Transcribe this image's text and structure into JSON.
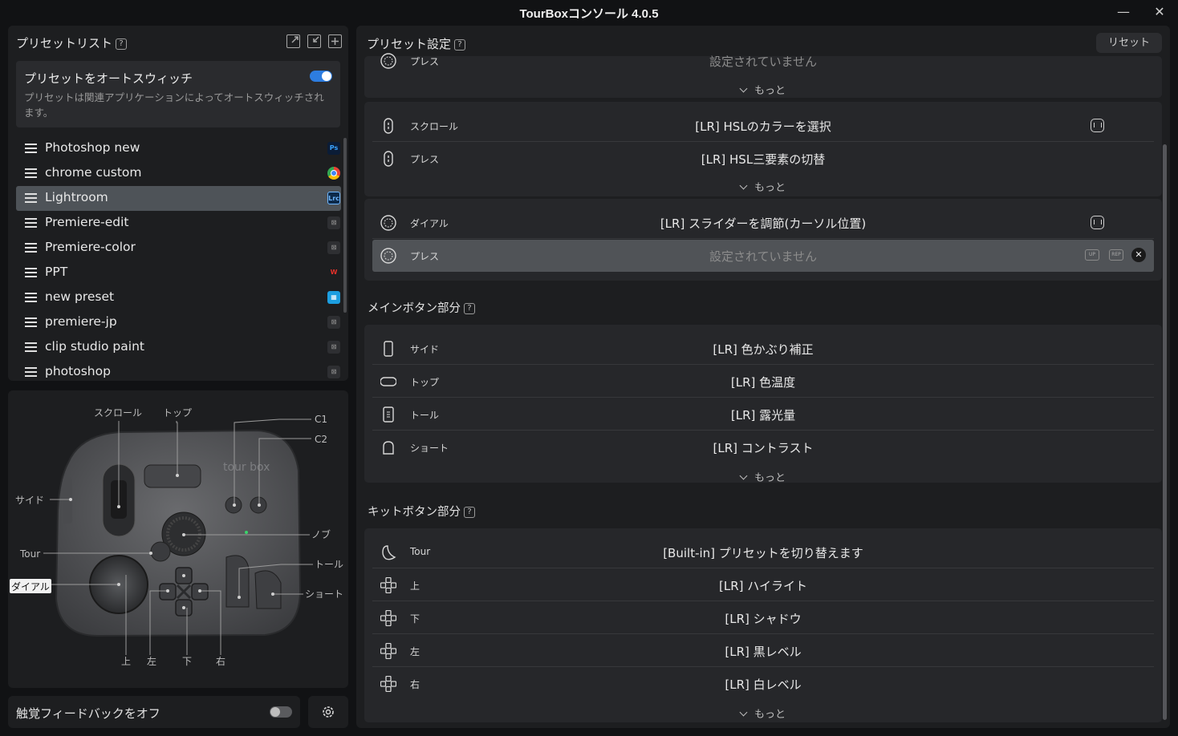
{
  "window": {
    "title": "TourBoxコンソール 4.0.5",
    "minimize": "—",
    "close": "✕"
  },
  "preset_panel": {
    "title": "プリセットリスト",
    "help": "?",
    "autoswitch": {
      "title": "プリセットをオートスウィッチ",
      "description": "プリセットは関連アプリケーションによってオートスウィッチされます。",
      "enabled": true
    },
    "presets": [
      {
        "name": "Photoshop new",
        "app_icon": "photoshop-icon",
        "app_text": "Ps",
        "active": false
      },
      {
        "name": "chrome custom",
        "app_icon": "chrome-icon",
        "app_text": "",
        "active": false
      },
      {
        "name": "Lightroom",
        "app_icon": "lightroom-icon",
        "app_text": "Lrc",
        "active": true
      },
      {
        "name": "Premiere-edit",
        "app_icon": "generic-app-icon",
        "app_text": "",
        "active": false
      },
      {
        "name": "Premiere-color",
        "app_icon": "generic-app-icon",
        "app_text": "",
        "active": false
      },
      {
        "name": "PPT",
        "app_icon": "wps-icon",
        "app_text": "W",
        "active": false
      },
      {
        "name": "new preset",
        "app_icon": "grid-app-icon",
        "app_text": "",
        "active": false
      },
      {
        "name": "premiere-jp",
        "app_icon": "generic-app-icon",
        "app_text": "",
        "active": false
      },
      {
        "name": "clip studio paint",
        "app_icon": "generic-app-icon",
        "app_text": "",
        "active": false
      },
      {
        "name": "photoshop",
        "app_icon": "generic-app-icon",
        "app_text": "",
        "active": false
      }
    ]
  },
  "device": {
    "labels": {
      "scroll": "スクロール",
      "top": "トップ",
      "c1": "C1",
      "c2": "C2",
      "side": "サイド",
      "knob": "ノブ",
      "tour": "Tour",
      "tall": "トール",
      "dial": "ダイアル",
      "short": "ショート",
      "up": "上",
      "left": "左",
      "down": "下",
      "right": "右",
      "logo": "tour box"
    }
  },
  "haptic": {
    "label": "触覚フィードバックをオフ",
    "enabled": false
  },
  "settings": {
    "title": "プリセット設定",
    "help": "?",
    "reset": "リセット",
    "more": "もっと",
    "top_card": {
      "label": "プレス",
      "value": "設定されていません"
    },
    "scroll_card": [
      {
        "label": "スクロール",
        "value": "[LR] HSLのカラーを選択",
        "has_wave": true
      },
      {
        "label": "プレス",
        "value": "[LR] HSL三要素の切替",
        "has_wave": false
      }
    ],
    "dial_card": [
      {
        "label": "ダイアル",
        "value": "[LR] スライダーを調節(カーソル位置)",
        "has_wave": true
      },
      {
        "label": "プレス",
        "value": "設定されていません",
        "selected": true,
        "up": "UP",
        "rep": "REP"
      }
    ],
    "main_section": {
      "title": "メインボタン部分",
      "rows": [
        {
          "label": "サイド",
          "value": "[LR] 色かぶり補正"
        },
        {
          "label": "トップ",
          "value": "[LR] 色温度"
        },
        {
          "label": "トール",
          "value": "[LR] 露光量"
        },
        {
          "label": "ショート",
          "value": "[LR] コントラスト"
        }
      ]
    },
    "kit_section": {
      "title": "キットボタン部分",
      "rows": [
        {
          "label": "Tour",
          "value": "[Built-in] プリセットを切り替えます"
        },
        {
          "label": "上",
          "value": "[LR] ハイライト"
        },
        {
          "label": "下",
          "value": "[LR] シャドウ"
        },
        {
          "label": "左",
          "value": "[LR] 黒レベル"
        },
        {
          "label": "右",
          "value": "[LR] 白レベル"
        }
      ]
    }
  },
  "colors": {
    "accent": "#2d7de0",
    "panel": "#1d1e20",
    "card": "#26272a",
    "selected": "#505357"
  }
}
